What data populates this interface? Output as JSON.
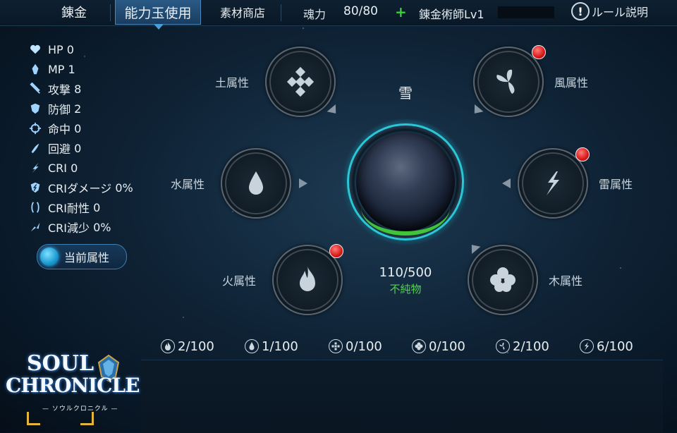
{
  "tabs": [
    {
      "label": "錬金"
    },
    {
      "label": "能力玉使用"
    },
    {
      "label": "素材商店"
    }
  ],
  "header": {
    "soul_label": "魂力",
    "soul_value": "80/80",
    "plus_icon": "plus-icon",
    "rank_label": "錬金術師Lv1",
    "rule_label": "ルール説明"
  },
  "stats": [
    {
      "icon": "heart-icon",
      "label": "HP",
      "value": "0"
    },
    {
      "icon": "mana-icon",
      "label": "MP",
      "value": "1"
    },
    {
      "icon": "sword-icon",
      "label": "攻撃",
      "value": "8"
    },
    {
      "icon": "shield-icon",
      "label": "防御",
      "value": "2"
    },
    {
      "icon": "crosshair-icon",
      "label": "命中",
      "value": "0"
    },
    {
      "icon": "evade-icon",
      "label": "回避",
      "value": "0"
    },
    {
      "icon": "critical-icon",
      "label": "CRI",
      "value": "0"
    },
    {
      "icon": "critical-damage-icon",
      "label": "CRIダメージ",
      "value": "0%"
    },
    {
      "icon": "critical-resist-icon",
      "label": "CRI耐性",
      "value": "0"
    },
    {
      "icon": "critical-reduce-icon",
      "label": "CRI減少",
      "value": "0%"
    }
  ],
  "current_attr_button": "当前属性",
  "elements": {
    "earth": {
      "label": "土属性",
      "notify": false
    },
    "wind": {
      "label": "風属性",
      "notify": true
    },
    "water": {
      "label": "水属性",
      "notify": false
    },
    "thunder": {
      "label": "雷属性",
      "notify": true
    },
    "fire": {
      "label": "火属性",
      "notify": true
    },
    "wood": {
      "label": "木属性",
      "notify": false
    }
  },
  "orb": {
    "title": "雪",
    "progress": "110/500",
    "progress_fraction": 0.22,
    "quality": "不純物"
  },
  "counters": [
    {
      "icon": "fire-icon",
      "value": "2/100"
    },
    {
      "icon": "water-icon",
      "value": "1/100"
    },
    {
      "icon": "earth-icon",
      "value": "0/100"
    },
    {
      "icon": "wood-icon",
      "value": "0/100"
    },
    {
      "icon": "wind-icon",
      "value": "2/100"
    },
    {
      "icon": "thunder-icon",
      "value": "6/100"
    }
  ],
  "logo": {
    "line1": "SOUL",
    "line2": "CHRONICLE",
    "subtitle": "— ソウルクロニクル —"
  },
  "colors": {
    "accent": "#2bc6d8",
    "plus": "#3ad13a",
    "quality": "#56d157",
    "badge": "#d81818"
  }
}
